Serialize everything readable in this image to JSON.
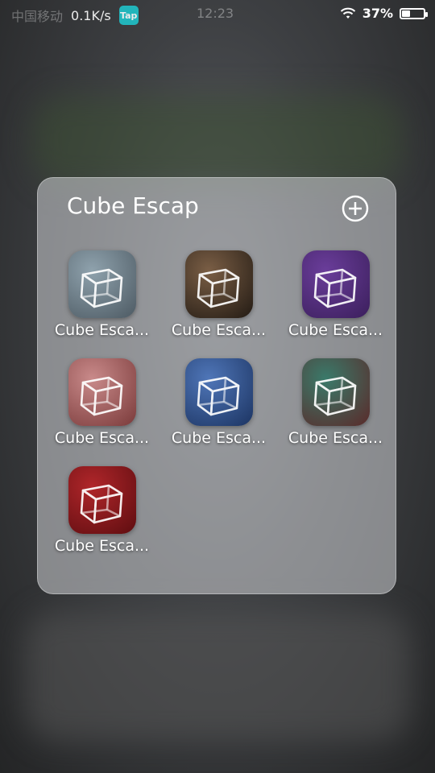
{
  "status_bar": {
    "carrier": "中国移动",
    "net_speed": "0.1K/s",
    "tap_badge": "Tap",
    "time": "12:23",
    "battery": "37%",
    "battery_level": 0.37
  },
  "folder": {
    "title": "Cube Escap",
    "add_icon": "plus-circle-icon",
    "apps": [
      {
        "label": "Cube Esca...",
        "icon": "cube-icon",
        "bg": [
          "#8fa2ad",
          "#4d5a63"
        ]
      },
      {
        "label": "Cube Esca...",
        "icon": "cube-icon",
        "bg": [
          "#7a5e45",
          "#231b14"
        ]
      },
      {
        "label": "Cube Esca...",
        "icon": "cube-icon",
        "bg": [
          "#6a3d9a",
          "#3b1f5c"
        ]
      },
      {
        "label": "Cube Esca...",
        "icon": "cube-icon",
        "bg": [
          "#c98a8a",
          "#7a3a3a"
        ]
      },
      {
        "label": "Cube Esca...",
        "icon": "cube-icon",
        "bg": [
          "#4f76b8",
          "#1c3462"
        ]
      },
      {
        "label": "Cube Esca...",
        "icon": "cube-icon",
        "bg": [
          "#3a7a6a",
          "#5a2a2a"
        ]
      },
      {
        "label": "Cube Esca...",
        "icon": "cube-icon",
        "bg": [
          "#b0262a",
          "#5e0d10"
        ]
      }
    ]
  }
}
